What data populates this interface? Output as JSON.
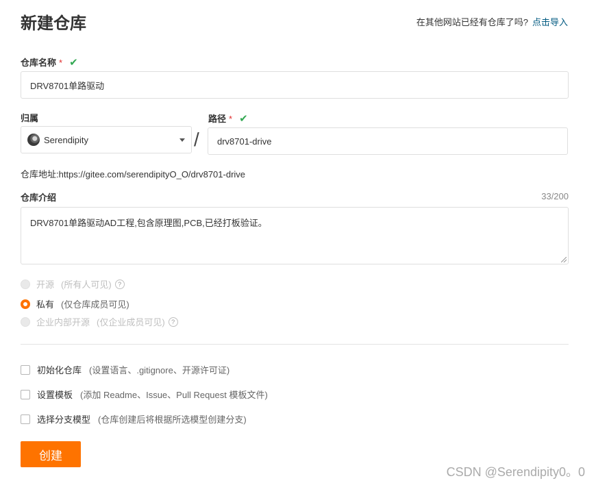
{
  "header": {
    "title": "新建仓库",
    "import_question": "在其他网站已经有仓库了吗?",
    "import_link": "点击导入"
  },
  "repo_name": {
    "label": "仓库名称",
    "required_mark": "*",
    "check": "✔",
    "value": "DRV8701单路驱动"
  },
  "owner": {
    "label": "归属",
    "value": "Serendipity"
  },
  "path": {
    "label": "路径",
    "required_mark": "*",
    "check": "✔",
    "separator": "/",
    "value": "drv8701-drive"
  },
  "address": {
    "text": "仓库地址:https://gitee.com/serendipityO_O/drv8701-drive"
  },
  "description": {
    "label": "仓库介绍",
    "counter": "33/200",
    "value": "DRV8701单路驱动AD工程,包含原理图,PCB,已经打板验证。"
  },
  "visibility": [
    {
      "label": "开源",
      "hint": "(所有人可见)",
      "help": "?",
      "state": "disabled"
    },
    {
      "label": "私有",
      "hint": "(仅仓库成员可见)",
      "help": "",
      "state": "selected"
    },
    {
      "label": "企业内部开源",
      "hint": "(仅企业成员可见)",
      "help": "?",
      "state": "disabled"
    }
  ],
  "options": [
    {
      "label": "初始化仓库",
      "hint": "(设置语言、.gitignore、开源许可证)",
      "checked": false
    },
    {
      "label": "设置模板",
      "hint": "(添加 Readme、Issue、Pull Request 模板文件)",
      "checked": false
    },
    {
      "label": "选择分支模型",
      "hint": "(仓库创建后将根据所选模型创建分支)",
      "checked": false
    }
  ],
  "submit": {
    "label": "创建"
  },
  "watermark": {
    "text": "CSDN @Serendipity0。0"
  },
  "colors": {
    "accent": "#fe7300",
    "link": "#005980",
    "check": "#32a852",
    "required": "#e02d2d"
  }
}
